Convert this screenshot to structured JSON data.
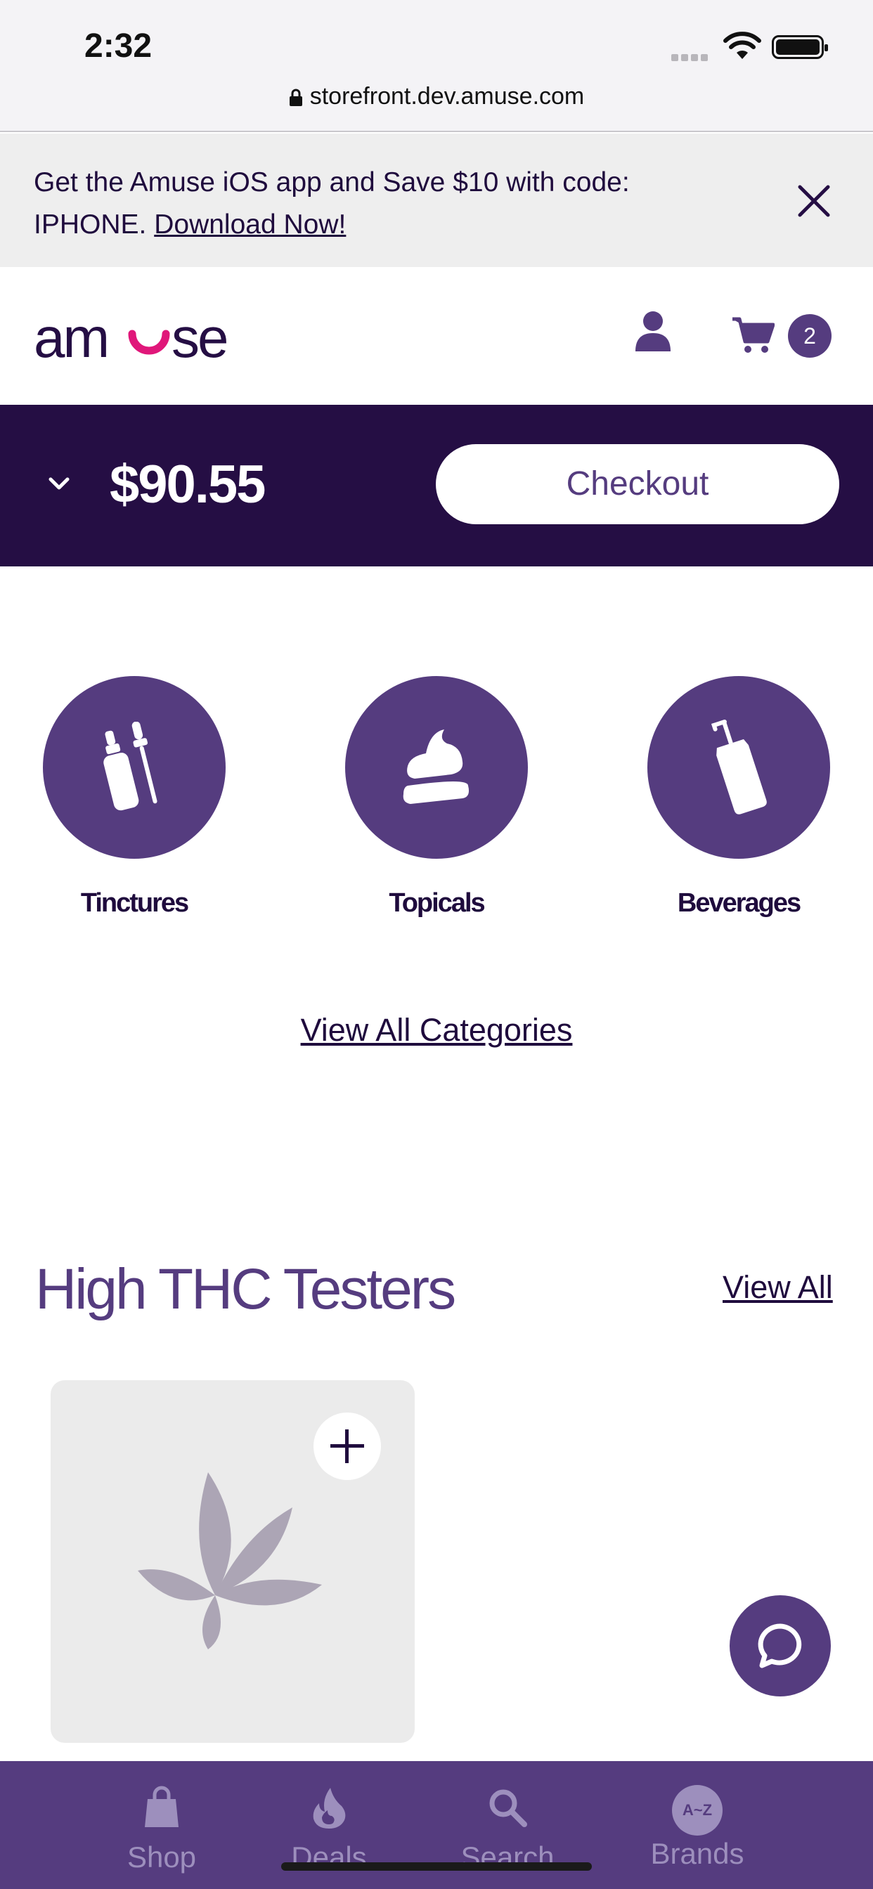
{
  "status_bar": {
    "time": "2:32",
    "url": "storefront.dev.amuse.com"
  },
  "promo": {
    "text": "Get the Amuse iOS app and Save $10 with code: IPHONE.",
    "link": "Download Now!"
  },
  "header": {
    "logo_text": "amuse",
    "cart_count": "2"
  },
  "cart_bar": {
    "total": "$90.55",
    "checkout_label": "Checkout"
  },
  "categories": [
    {
      "label": "Tinctures",
      "icon": "tincture-icon"
    },
    {
      "label": "Topicals",
      "icon": "topical-icon"
    },
    {
      "label": "Beverages",
      "icon": "beverage-icon"
    }
  ],
  "view_all_categories": "View All Categories",
  "section": {
    "title": "High THC Testers",
    "view_all": "View All"
  },
  "bottom_nav": [
    {
      "label": "Shop",
      "icon": "shopping-bag-icon"
    },
    {
      "label": "Deals",
      "icon": "flame-icon"
    },
    {
      "label": "Search",
      "icon": "search-icon"
    },
    {
      "label": "Brands",
      "icon": "a-z-icon",
      "badge": "A~Z"
    }
  ],
  "colors": {
    "brand_purple": "#553c7f",
    "dark_purple": "#250e44",
    "logo_pink": "#e0177a",
    "nav_inactive": "#9d8fbd"
  }
}
